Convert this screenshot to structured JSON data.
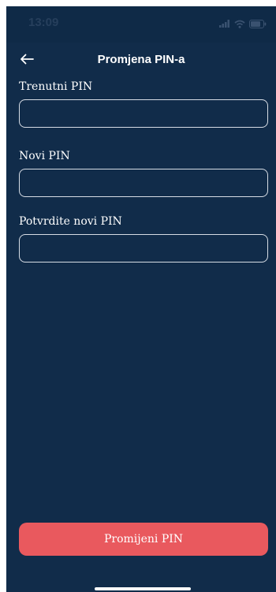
{
  "status_bar": {
    "time": "13:09",
    "icons": [
      "signal-icon",
      "wifi-icon",
      "battery-icon"
    ]
  },
  "header": {
    "back_icon": "arrow-left-icon",
    "title": "Promjena PIN-a"
  },
  "form": {
    "current_pin": {
      "label": "Trenutni PIN",
      "value": ""
    },
    "new_pin": {
      "label": "Novi PIN",
      "value": ""
    },
    "confirm_pin": {
      "label": "Potvrdite novi PIN",
      "value": ""
    }
  },
  "actions": {
    "submit_label": "Promijeni PIN"
  },
  "colors": {
    "background": "#112c4a",
    "button": "#e9595e",
    "input_border": "#d7dde5"
  }
}
